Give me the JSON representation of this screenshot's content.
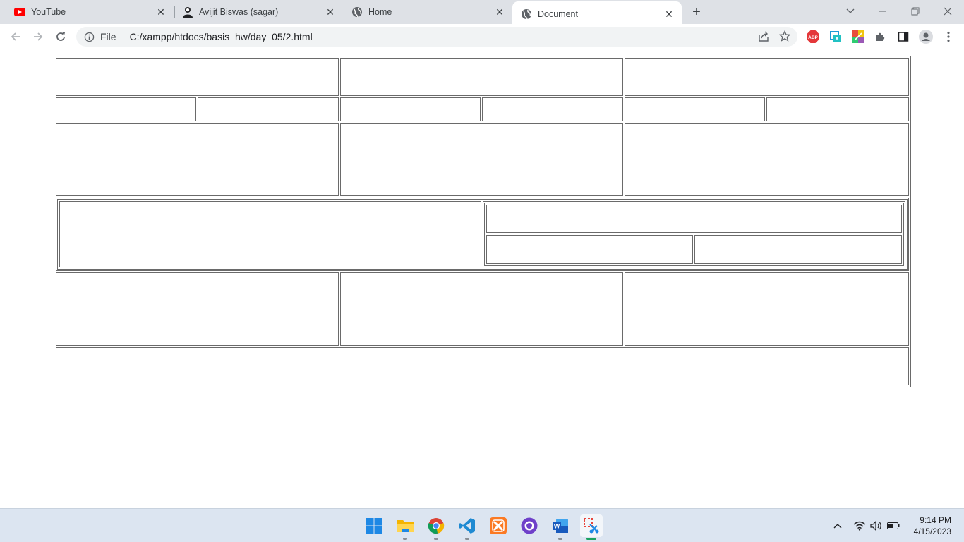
{
  "browser": {
    "tabs": [
      {
        "title": "YouTube",
        "favicon": "youtube-icon"
      },
      {
        "title": "Avijit Biswas (sagar)",
        "favicon": "user-silhouette-icon"
      },
      {
        "title": "Home",
        "favicon": "globe-icon"
      },
      {
        "title": "Document",
        "favicon": "globe-icon",
        "active": true
      }
    ],
    "omnibox": {
      "scheme_label": "File",
      "url": "C:/xampp/htdocs/basis_hw/day_05/2.html"
    },
    "extensions": [
      "abp-icon",
      "screen-capture-icon",
      "color-picker-icon",
      "puzzle-icon",
      "side-panel-icon",
      "profile-icon",
      "kebab-menu-icon"
    ]
  },
  "taskbar": {
    "apps": [
      "windows-start-icon",
      "file-explorer-icon",
      "chrome-icon",
      "vscode-icon",
      "xampp-icon",
      "github-desktop-icon",
      "word-icon",
      "snipping-tool-icon"
    ],
    "time": "9:14 PM",
    "date": "4/15/2023"
  },
  "colors": {
    "tabstrip": "#dee1e6",
    "table_border": "#6a6a6a",
    "taskbar": "#dce5f1"
  }
}
